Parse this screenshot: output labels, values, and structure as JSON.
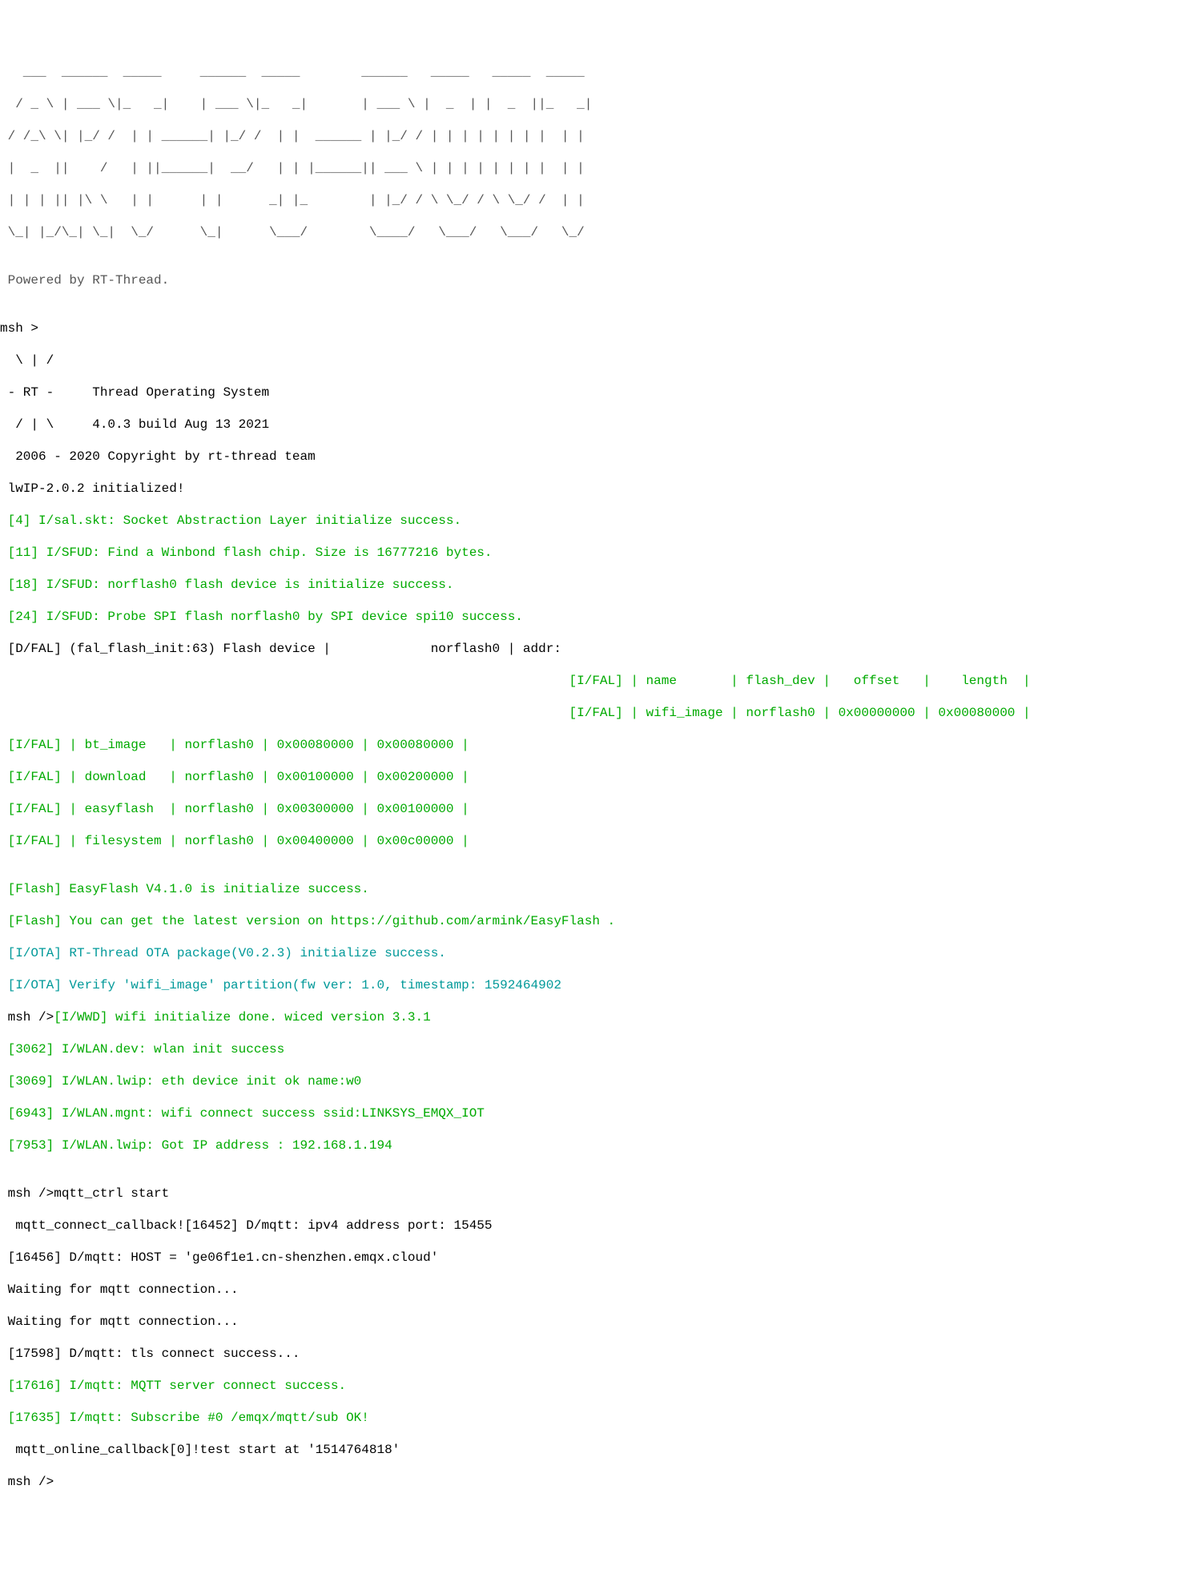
{
  "ascii_art": {
    "l1": "   ___  ______  _____     ______  _____        ______   _____   _____  _____",
    "l2": "  / _ \\ | ___ \\|_   _|    | ___ \\|_   _|       | ___ \\ |  _  | |  _  ||_   _|",
    "l3": " / /_\\ \\| |_/ /  | | ______| |_/ /  | |  ______ | |_/ / | | | | | | | |  | |",
    "l4": " |  _  ||    /   | ||______|  __/   | | |______|| ___ \\ | | | | | | | |  | |",
    "l5": " | | | || |\\ \\   | |      | |      _| |_        | |_/ / \\ \\_/ / \\ \\_/ /  | |",
    "l6": " \\_| |_/\\_| \\_|  \\_/      \\_|      \\___/        \\____/   \\___/   \\___/   \\_/"
  },
  "powered": " Powered by RT-Thread.",
  "blank": "",
  "msh_prompt": "msh >",
  "slash1": "  \\ | /",
  "rt_line": " - RT -     Thread Operating System",
  "slash2": "  / | \\     4.0.3 build Aug 13 2021",
  "copyright": "  2006 - 2020 Copyright by rt-thread team",
  "lwip": " lwIP-2.0.2 initialized!",
  "sal": " [4] I/sal.skt: Socket Abstraction Layer initialize success.",
  "sfud1": " [11] I/SFUD: Find a Winbond flash chip. Size is 16777216 bytes.",
  "sfud2": " [18] I/SFUD: norflash0 flash device is initialize success.",
  "sfud3": " [24] I/SFUD: Probe SPI flash norflash0 by SPI device spi10 success.",
  "dfal": " [D/FAL] (fal_flash_init:63) Flash device |             norflash0 | addr:",
  "header_row": "                                                                          [I/FAL] | name       | flash_dev |   offset   |    length  |",
  "wifi_row": "                                                                          [I/FAL] | wifi_image | norflash0 | 0x00000000 | 0x00080000 |",
  "bt_row": " [I/FAL] | bt_image   | norflash0 | 0x00080000 | 0x00080000 |",
  "dl_row": " [I/FAL] | download   | norflash0 | 0x00100000 | 0x00200000 |",
  "ef_row": " [I/FAL] | easyflash  | norflash0 | 0x00300000 | 0x00100000 |",
  "fs_row": " [I/FAL] | filesystem | norflash0 | 0x00400000 | 0x00c00000 |",
  "flash1": " [Flash] EasyFlash V4.1.0 is initialize success.",
  "flash2": " [Flash] You can get the latest version on https://github.com/armink/EasyFlash .",
  "ota1": " [I/OTA] RT-Thread OTA package(V0.2.3) initialize success.",
  "ota2": " [I/OTA] Verify 'wifi_image' partition(fw ver: 1.0, timestamp: 1592464902",
  "wwd_prefix": " msh />",
  "wwd_suffix": "[I/WWD] wifi initialize done. wiced version 3.3.1",
  "wlan1": " [3062] I/WLAN.dev: wlan init success",
  "wlan2": " [3069] I/WLAN.lwip: eth device init ok name:w0",
  "wlan3": " [6943] I/WLAN.mgnt: wifi connect success ssid:LINKSYS_EMQX_IOT",
  "wlan4": " [7953] I/WLAN.lwip: Got IP address : 192.168.1.194",
  "mqtt_cmd": " msh />mqtt_ctrl start",
  "mqtt_cb_prefix": "  mqtt_connect_callback!",
  "mqtt_cb_suffix": "[16452] D/mqtt: ipv4 address port: 15455",
  "mqtt_host": " [16456] D/mqtt: HOST = 'ge06f1e1.cn-shenzhen.emqx.cloud'",
  "wait1": " Waiting for mqtt connection...",
  "wait2": " Waiting for mqtt connection...",
  "tls": " [17598] D/mqtt: tls connect success...",
  "mqtt_conn": " [17616] I/mqtt: MQTT server connect success.",
  "mqtt_sub": " [17635] I/mqtt: Subscribe #0 /emqx/mqtt/sub OK!",
  "online": "  mqtt_online_callback[0]!test start at '1514764818'",
  "final_prompt": " msh />"
}
